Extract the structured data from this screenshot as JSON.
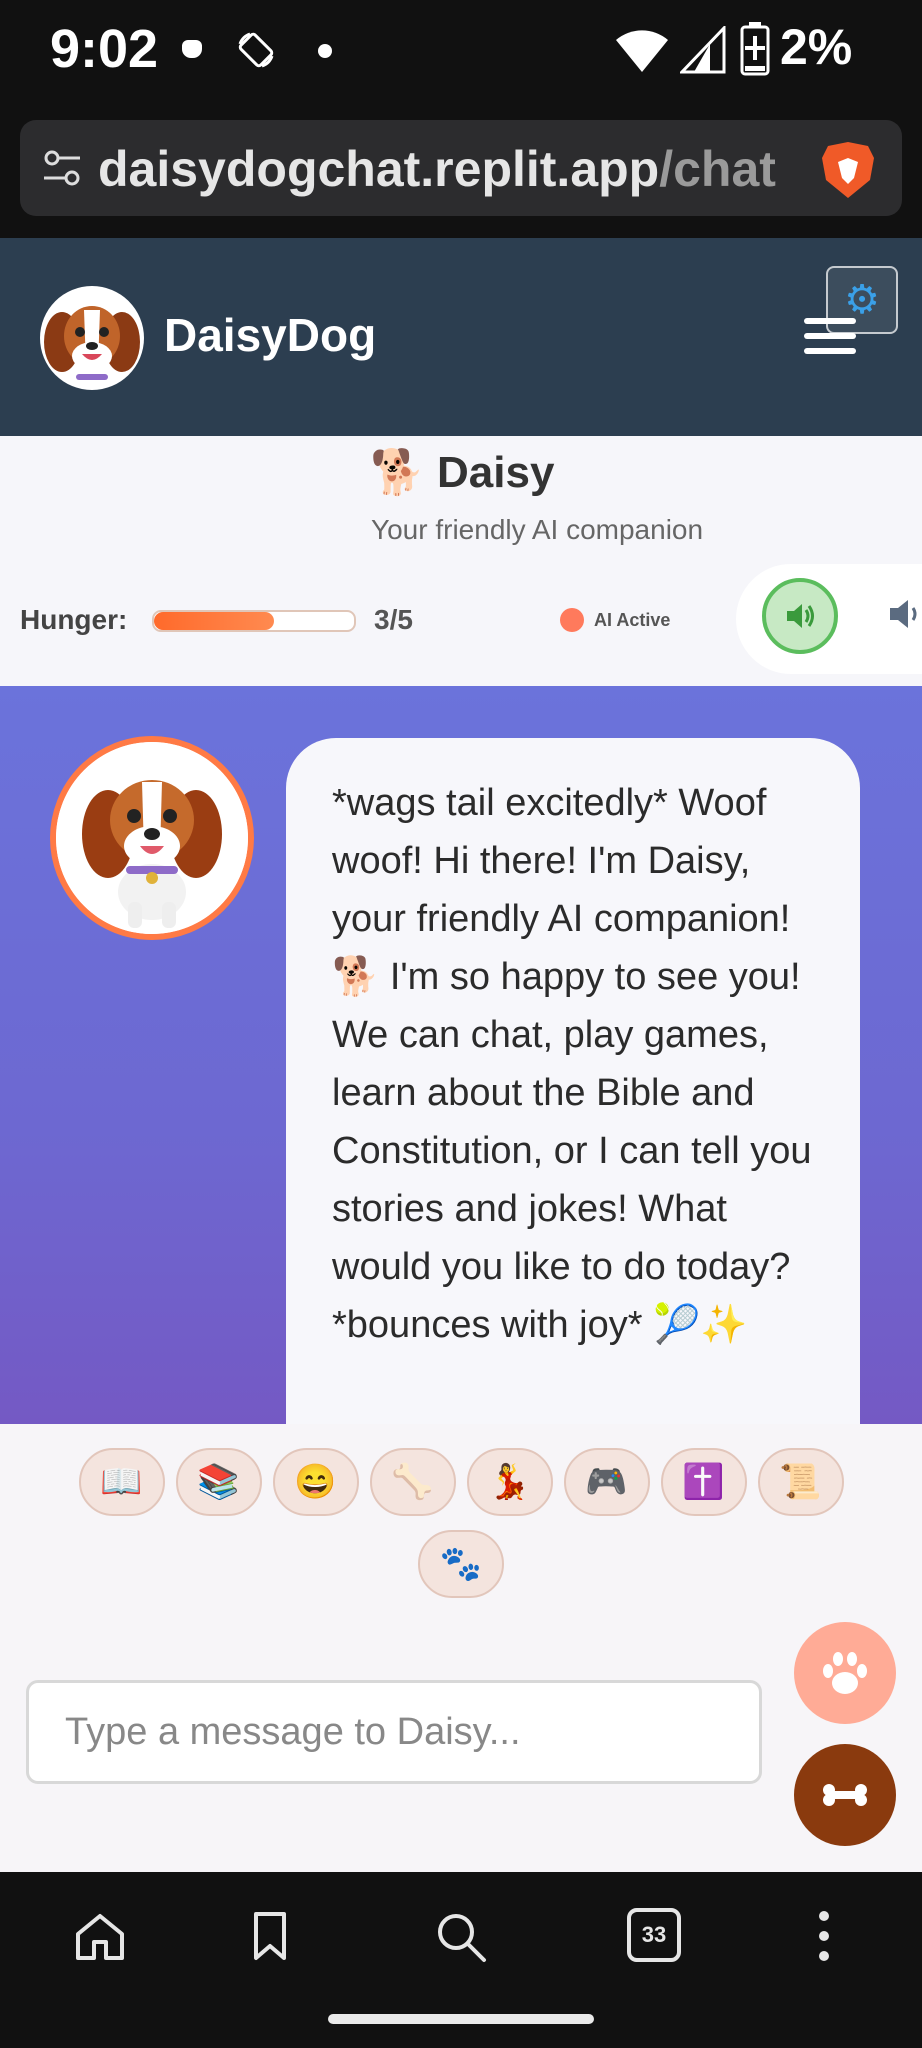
{
  "status_bar": {
    "time": "9:02",
    "battery": "2%"
  },
  "browser": {
    "url_host": "daisydogchat.replit.app",
    "url_path": "/chat",
    "tabs_count": "33"
  },
  "header": {
    "brand": "DaisyDog"
  },
  "pet": {
    "emoji": "🐕",
    "name": "Daisy",
    "subtitle": "Your friendly AI companion",
    "hunger_label": "Hunger:",
    "hunger_value": "3/5",
    "hunger_level": 3,
    "hunger_max": 5,
    "ai_status": "AI Active"
  },
  "chat": {
    "messages": [
      {
        "sender": "daisy",
        "text": "*wags tail excitedly* Woof woof! Hi there! I'm Daisy, your friendly AI companion! 🐕 I'm so happy to see you! We can chat, play games, learn about the Bible and Constitution, or I can tell you stories and jokes! What would you like to do today? *bounces with joy* 🎾✨"
      }
    ]
  },
  "quick_actions": [
    {
      "emoji": "📖",
      "name": "story"
    },
    {
      "emoji": "📚",
      "name": "learn"
    },
    {
      "emoji": "😄",
      "name": "joke"
    },
    {
      "emoji": "🦴",
      "name": "bone"
    },
    {
      "emoji": "💃",
      "name": "dance"
    },
    {
      "emoji": "🎮",
      "name": "game"
    },
    {
      "emoji": "✝️",
      "name": "bible"
    },
    {
      "emoji": "📜",
      "name": "constitution"
    },
    {
      "emoji": "🐾",
      "name": "tricks"
    }
  ],
  "input": {
    "placeholder": "Type a message to Daisy..."
  },
  "colors": {
    "header_bg": "#2c3e50",
    "accent": "#ff7a45",
    "chat_bg": "#6b73db",
    "feed_fab": "#8a3a0e",
    "pet_fab": "#ffab96"
  },
  "icons": {
    "settings": "gear-icon",
    "menu": "hamburger-menu-icon",
    "voice": "speaker-icon",
    "pet_fab": "paw-icon",
    "feed_fab": "bone-icon",
    "nav": [
      "home-icon",
      "bookmark-icon",
      "search-icon",
      "tabs-icon",
      "more-vertical-icon"
    ]
  }
}
